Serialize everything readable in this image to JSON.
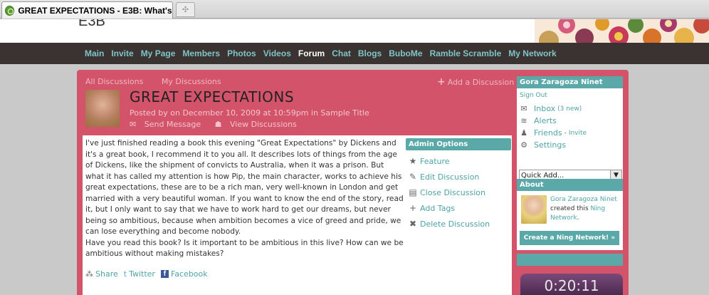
{
  "browser": {
    "tab_title": "GREAT EXPECTATIONS - E3B: What's ...",
    "new_tab_icon": "plus-icon"
  },
  "header": {
    "site_name": "E3B"
  },
  "nav": {
    "items": [
      {
        "label": "Main"
      },
      {
        "label": "Invite"
      },
      {
        "label": "My Page"
      },
      {
        "label": "Members"
      },
      {
        "label": "Photos"
      },
      {
        "label": "Videos"
      },
      {
        "label": "Forum",
        "active": true
      },
      {
        "label": "Chat"
      },
      {
        "label": "Blogs"
      },
      {
        "label": "BuboMe"
      },
      {
        "label": "Ramble Scramble"
      },
      {
        "label": "My Network"
      }
    ]
  },
  "discussion": {
    "subnav": [
      "All Discussions",
      "My Discussions"
    ],
    "add_discussion": "Add a Discussion",
    "title": "GREAT EXPECTATIONS",
    "meta": "Posted by  on December 10, 2009 at 10:59pm in Sample Title",
    "send_message": "Send Message",
    "view_discussions": "View Discussions",
    "body_p1": "I've just finished reading a book this evening \"Great Expectations\" by Dickens and it's a great book, I recommend it to you all. It describes lots of things from the age of Dickens, like the shipment of convicts to Australia, when it was a prison. But what it has called my attention is how Pip, the main character, works to achieve his great expectations, these are to be a rich man, very well-known in London and get married with a very beautiful woman. If you want to know the end of the story, read it, but I only want to say that we have to work hard to get our dreams, but never being so ambitious, because when ambition becomes a vice of greed and pride, we can lose everything and become nobody.",
    "body_p2": "Have you read this book? Is it important to be ambitious in this live? How can we be ambitious without making mistakes?",
    "share": {
      "share": "Share",
      "twitter": "Twitter",
      "facebook": "Facebook"
    }
  },
  "admin": {
    "header": "Admin Options",
    "items": [
      {
        "label": "Feature",
        "icon": "star-icon"
      },
      {
        "label": "Edit Discussion",
        "icon": "pencil-icon"
      },
      {
        "label": "Close Discussion",
        "icon": "close-discussion-icon"
      },
      {
        "label": "Add Tags",
        "icon": "plus-icon"
      },
      {
        "label": "Delete Discussion",
        "icon": "delete-icon"
      }
    ]
  },
  "sidebar": {
    "user_name": "Gora Zaragoza Ninet",
    "sign_out": "Sign Out",
    "inbox": "Inbox",
    "inbox_count": "(3 new)",
    "alerts": "Alerts",
    "friends": "Friends",
    "friends_sep": "-",
    "invite": "Invite",
    "settings": "Settings",
    "quick_add": "Quick Add...",
    "about_header": "About",
    "about_name": "Gora Zaragoza Ninet",
    "about_created": "created this",
    "about_ning": "Ning Network",
    "about_period": ".",
    "create_button": "Create a Ning Network! »",
    "timer": "0:20:11"
  }
}
